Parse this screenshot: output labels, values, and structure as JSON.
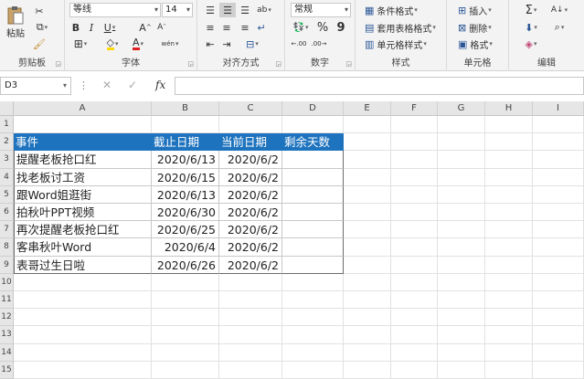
{
  "ribbon": {
    "clipboard": {
      "paste_label": "粘贴",
      "group_label": "剪贴板"
    },
    "font": {
      "font_name": "等线",
      "font_size": "14",
      "bold": "B",
      "italic": "I",
      "underline": "U",
      "increase_size": "A",
      "decrease_size": "A",
      "font_color": "A",
      "phonetic": "wén",
      "group_label": "字体"
    },
    "alignment": {
      "group_label": "对齐方式"
    },
    "number": {
      "format": "常规",
      "percent": "%",
      "comma": "9",
      "group_label": "数字"
    },
    "styles": {
      "conditional": "条件格式",
      "table_format": "套用表格格式",
      "cell_styles": "单元格样式",
      "group_label": "样式"
    },
    "cells": {
      "insert": "插入",
      "delete": "删除",
      "format": "格式",
      "group_label": "单元格"
    },
    "editing": {
      "sum": "Σ",
      "group_label": "编辑"
    }
  },
  "formula_bar": {
    "name_box": "D3",
    "fx": "fx",
    "value": ""
  },
  "sheet": {
    "columns": [
      "A",
      "B",
      "C",
      "D",
      "E",
      "F",
      "G",
      "H",
      "I"
    ],
    "rows": [
      "1",
      "2",
      "3",
      "4",
      "5",
      "6",
      "7",
      "8",
      "9",
      "10",
      "11",
      "12",
      "13",
      "14",
      "15"
    ],
    "header": [
      "事件",
      "截止日期",
      "当前日期",
      "剩余天数"
    ],
    "data": [
      [
        "提醒老板抢口红",
        "2020/6/13",
        "2020/6/2",
        ""
      ],
      [
        "找老板讨工资",
        "2020/6/15",
        "2020/6/2",
        ""
      ],
      [
        "跟Word姐逛街",
        "2020/6/13",
        "2020/6/2",
        ""
      ],
      [
        "拍秋叶PPT视频",
        "2020/6/30",
        "2020/6/2",
        ""
      ],
      [
        "再次提醒老板抢口红",
        "2020/6/25",
        "2020/6/2",
        ""
      ],
      [
        "客串秋叶Word",
        "2020/6/4",
        "2020/6/2",
        ""
      ],
      [
        "表哥过生日啦",
        "2020/6/26",
        "2020/6/2",
        ""
      ]
    ],
    "colors": {
      "header_fill": "#1e73be",
      "header_text": "#ffffff"
    }
  }
}
